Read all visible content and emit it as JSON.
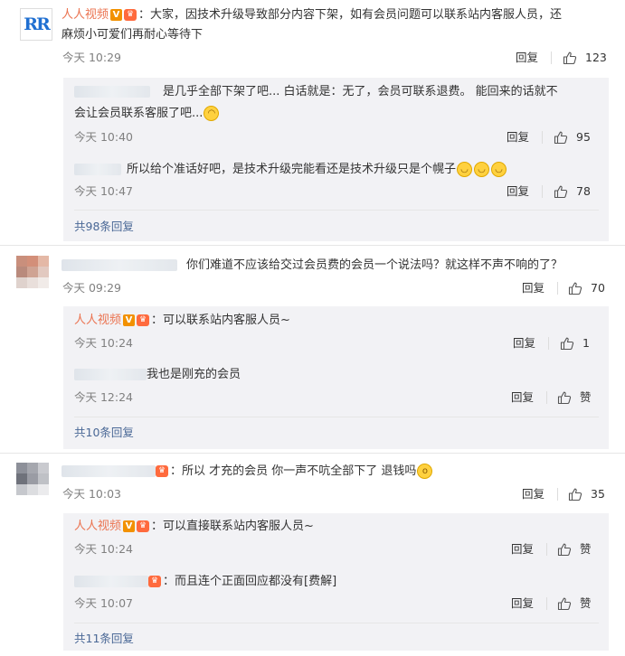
{
  "comments": [
    {
      "user": "人人视频",
      "text_line1": "：大家，因技术升级导致部分内容下架，如有会员问题可以联系站内客服人员，还",
      "text_line2": "麻烦小可爱们再耐心等待下",
      "time": "今天 10:29",
      "reply_label": "回复",
      "likes": "123",
      "sub_replies": [
        {
          "text_line1": "是几乎全部下架了吧...  白话就是：无了，会员可联系退费。 能回来的话就不",
          "text_line2": "会让会员联系客服了吧...",
          "emoji": "😅",
          "time": "今天 10:40",
          "reply_label": "回复",
          "likes": "95"
        },
        {
          "text_line1": "所以给个准话好吧，是技术升级完能看还是技术升级只是个幌子",
          "emoji": "🙂",
          "time": "今天 10:47",
          "reply_label": "回复",
          "likes": "78"
        }
      ],
      "more": "共98条回复"
    },
    {
      "text_line1": "你们难道不应该给交过会员费的会员一个说法吗？就这样不声不响的了？",
      "time": "今天 09:29",
      "reply_label": "回复",
      "likes": "70",
      "sub_replies": [
        {
          "user": "人人视频",
          "text_line1": "：可以联系站内客服人员~",
          "time": "今天 10:24",
          "reply_label": "回复",
          "likes": "1"
        },
        {
          "text_line1": "我也是刚充的会员",
          "time": "今天 12:24",
          "reply_label": "回复",
          "likes": "赞"
        }
      ],
      "more": "共10条回复"
    },
    {
      "text_line1": "：所以 才充的会员 你一声不吭全部下了 退钱吗",
      "emoji": "😲",
      "time": "今天 10:03",
      "reply_label": "回复",
      "likes": "35",
      "sub_replies": [
        {
          "user": "人人视频",
          "text_line1": "：可以直接联系站内客服人员~",
          "time": "今天 10:24",
          "reply_label": "回复",
          "likes": "赞"
        },
        {
          "text_line1": "：而且连个正面回应都没有[费解]",
          "time": "今天 10:07",
          "reply_label": "回复",
          "likes": "赞"
        }
      ],
      "more": "共11条回复"
    }
  ],
  "icons": {
    "thumb": "thumb-up-icon",
    "verified": "verified-v-icon",
    "medal": "fan-medal-icon",
    "avatar_logo": "RR"
  },
  "colors": {
    "username": "#eb7350",
    "link": "#4a6896",
    "sub_bg": "#f2f2f5",
    "verified": "#f29100"
  }
}
